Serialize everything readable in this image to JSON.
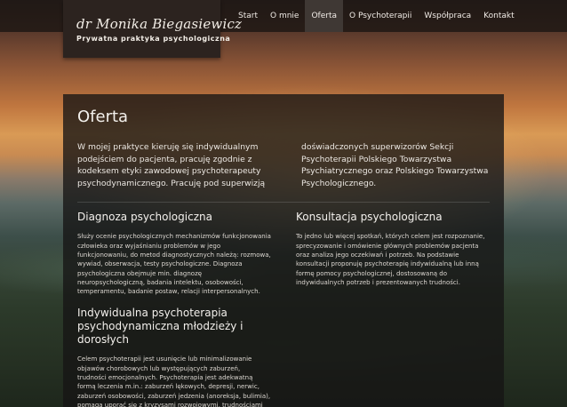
{
  "brand": {
    "name": "dr Monika Biegasiewicz",
    "subtitle": "Prywatna praktyka psychologiczna"
  },
  "nav": {
    "items": [
      {
        "label": "Start"
      },
      {
        "label": "O mnie"
      },
      {
        "label": "Oferta",
        "active": true
      },
      {
        "label": "O Psychoterapii"
      },
      {
        "label": "Współpraca"
      },
      {
        "label": "Kontakt"
      }
    ]
  },
  "main": {
    "title": "Oferta",
    "intro_left": "W mojej praktyce kieruję się indywidualnym podejściem do pacjenta, pracuję zgodnie z kodeksem etyki zawodowej psychoterapeuty psychodynamicznego. Pracuję pod superwizją",
    "intro_right": "doświadczonych superwizorów Sekcji Psychoterapii Polskiego Towarzystwa Psychiatrycznego oraz Polskiego Towarzystwa Psychologicznego.",
    "sections": [
      {
        "title": "Diagnoza psychologiczna",
        "text": "Służy ocenie psychologicznych mechanizmów funkcjonowania człowieka oraz wyjaśnianiu problemów w jego funkcjonowaniu, do metod diagnostycznych należą: rozmowa, wywiad, obserwacja, testy psychologiczne. Diagnoza psychologiczna obejmuje min. diagnozę neuropsychologiczną, badania intelektu, osobowości, temperamentu, badanie postaw, relacji interpersonalnych."
      },
      {
        "title": "Konsultacja psychologiczna",
        "text": "To jedno lub więcej spotkań, których celem jest rozpoznanie, sprecyzowanie i omówienie głównych problemów pacjenta oraz analiza jego oczekiwań i potrzeb. Na podstawie konsultacji proponuję psychoterapię indywidualną lub inną formę pomocy psychologicznej, dostosowaną do indywidualnych potrzeb i prezentowanych trudności."
      },
      {
        "title": "Indywidualna psychoterapia psychodynamiczna młodzieży i dorosłych",
        "text": "Celem psychoterapii jest usunięcie lub minimalizowanie objawów chorobowych lub występujących zaburzeń, trudności emocjonalnych. Psychoterapia jest adekwatną formą leczenia m.in.: zaburzeń lękowych, depresji, nerwic, zaburzeń osobowości, zaburzeń jedzenia (anoreksja, bulimia), pomaga uporać się z kryzysami rozwojowymi, trudnościami interpersonalnymi."
      }
    ]
  },
  "colors": {
    "panel_bg": "#161414",
    "brand_bg": "#2c231f",
    "nav_active_bg": "#3f3834",
    "text": "#eeeeee"
  }
}
